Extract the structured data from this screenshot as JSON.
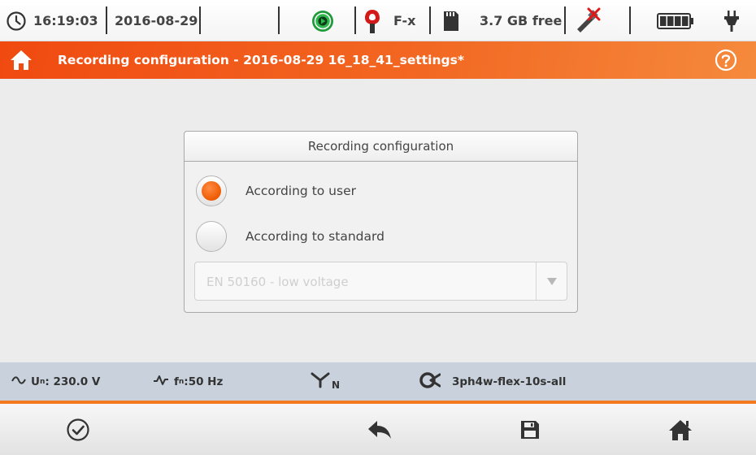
{
  "status_bar": {
    "time": "16:19:03",
    "date": "2016-08-29",
    "clamp_label": "F-x",
    "storage_free": "3.7 GB free",
    "icons": [
      "clock-icon",
      "recording-status-icon",
      "clamp-icon",
      "sd-card-icon",
      "usb-disconnected-icon",
      "battery-icon",
      "power-plug-icon"
    ]
  },
  "title_bar": {
    "title": "Recording configuration - 2016-08-29 16_18_41_settings*"
  },
  "dialog": {
    "header": "Recording configuration",
    "options": [
      {
        "label": "According to user",
        "selected": true
      },
      {
        "label": "According to standard",
        "selected": false
      }
    ],
    "standard_select": {
      "value": "EN 50160 - low voltage",
      "enabled": false
    }
  },
  "info_bar": {
    "voltage_prefix": "U",
    "voltage_sub": "n",
    "voltage_value": ": 230.0 V",
    "freq_prefix": "f",
    "freq_sub": "n",
    "freq_value": ":50 Hz",
    "network_sub": "N",
    "config_name": "3ph4w-flex-10s-all"
  },
  "colors": {
    "accent": "#f26722",
    "info_bar_bg": "#c9d2dc",
    "radio_selected": "#ee5a00"
  }
}
